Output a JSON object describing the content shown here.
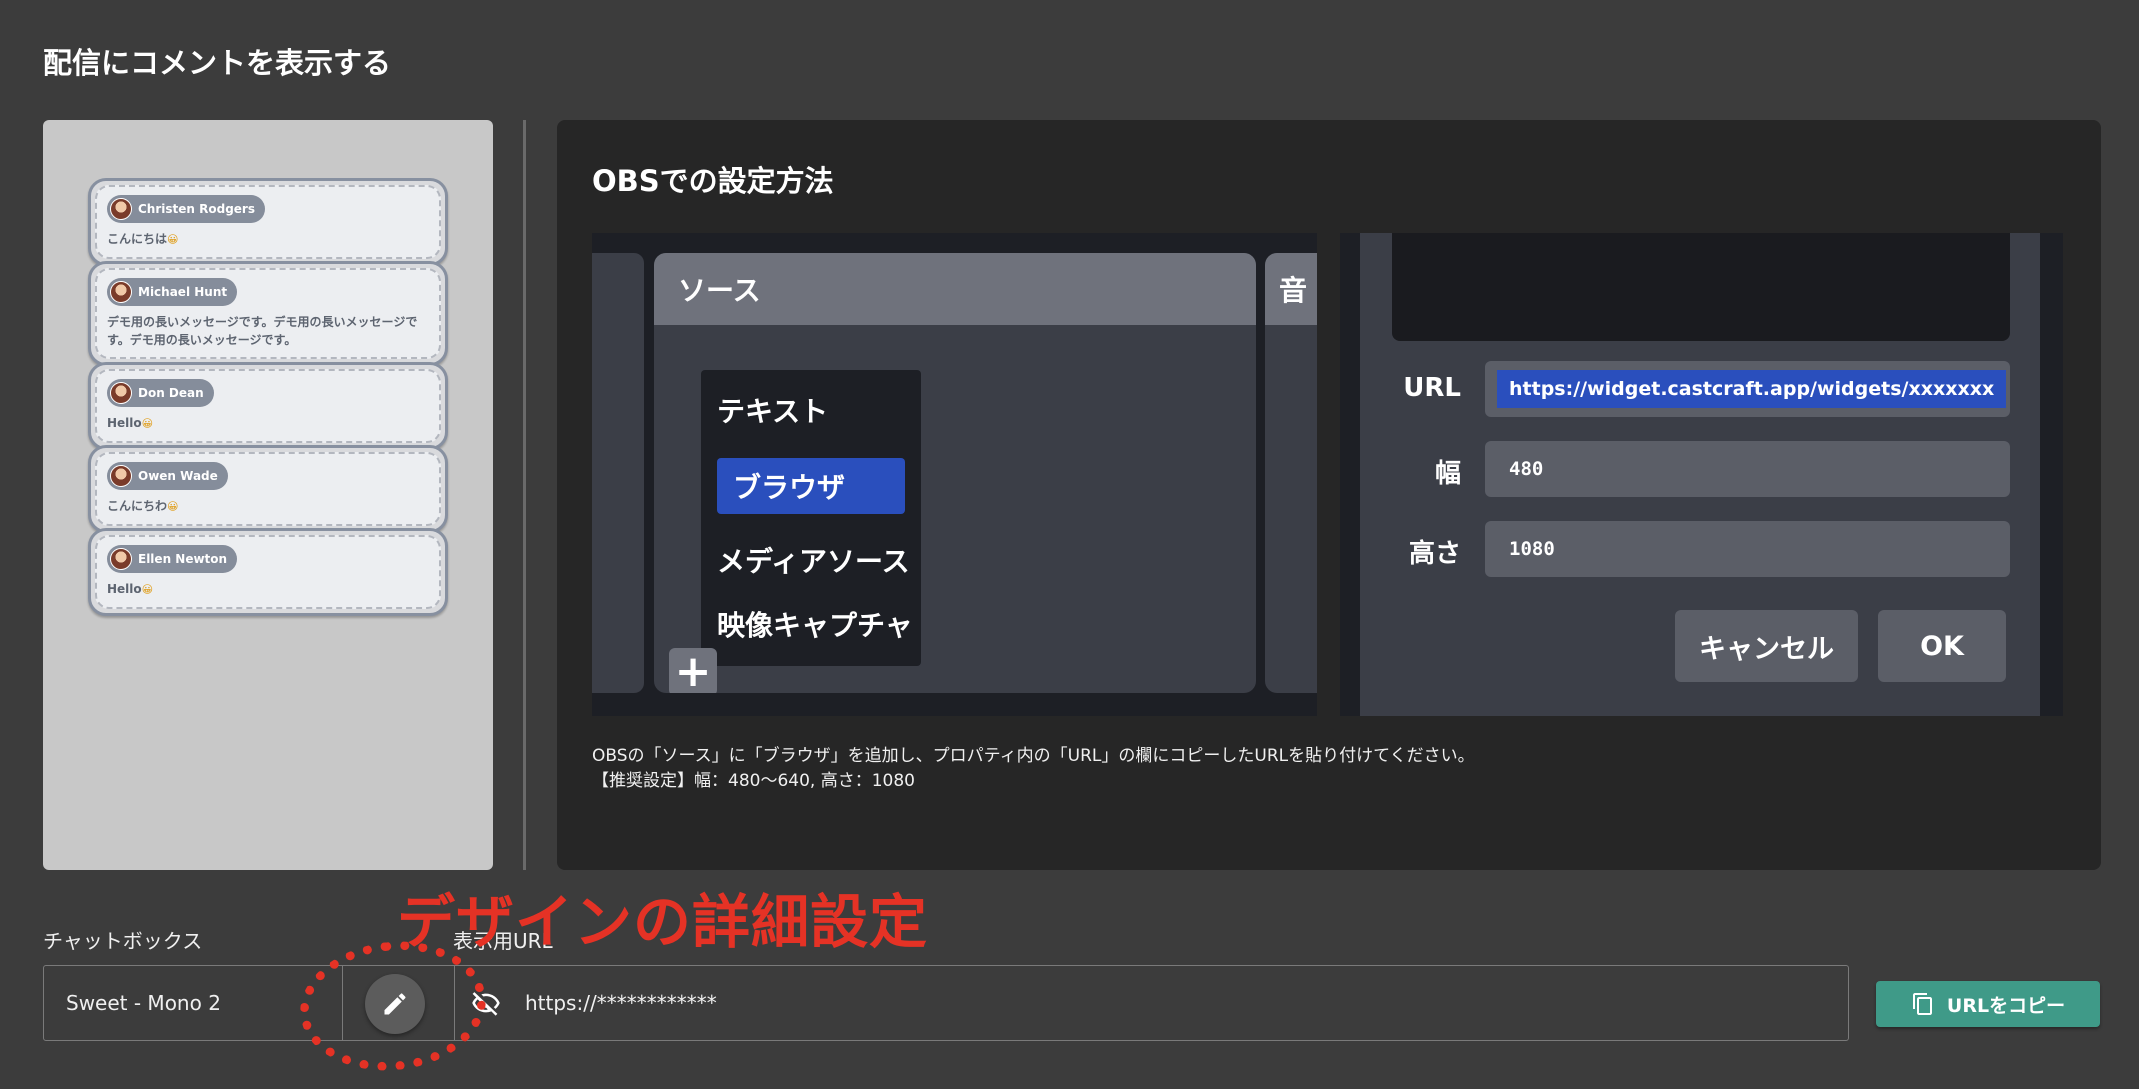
{
  "page": {
    "title": "配信にコメントを表示する"
  },
  "preview": {
    "comments": [
      {
        "name": "Christen Rodgers",
        "message": "こんにちは"
      },
      {
        "name": "Michael Hunt",
        "message": "デモ用の長いメッセージです。デモ用の長いメッセージです。デモ用の長いメッセージです。"
      },
      {
        "name": "Don Dean",
        "message": "Hello"
      },
      {
        "name": "Owen Wade",
        "message": "こんにちわ"
      },
      {
        "name": "Ellen Newton",
        "message": "Hello"
      }
    ],
    "emoji": "😀"
  },
  "obs": {
    "title": "OBSでの設定方法",
    "source_header": "ソース",
    "audio_header": "音",
    "menu": [
      "テキスト",
      "ブラウザ",
      "メディアソース",
      "映像キャプチャ"
    ],
    "plus": "+",
    "props": {
      "url_label": "URL",
      "url_value": "https://widget.castcraft.app/widgets/xxxxxxx",
      "width_label": "幅",
      "width_value": "480",
      "height_label": "高さ",
      "height_value": "1080",
      "cancel": "キャンセル",
      "ok": "OK"
    },
    "desc_line1": "OBSの「ソース」に「ブラウザ」を追加し、プロパティ内の「URL」の欄にコピーしたURLを貼り付けてください。",
    "desc_line2": "【推奨設定】幅：480～640, 高さ：1080"
  },
  "controls": {
    "annotation": "デザインの詳細設定",
    "chatbox_label": "チャットボックス",
    "chatbox_value": "Sweet - Mono 2",
    "url_label": "表示用URL",
    "url_value": "https://************",
    "copy_button": "URLをコピー",
    "icons": [
      "pencil-icon",
      "eye-off-icon",
      "copy-icon"
    ],
    "colors": {
      "accent": "#3f9a88",
      "highlight": "#2a4fbd",
      "annotation": "#e53225"
    }
  }
}
